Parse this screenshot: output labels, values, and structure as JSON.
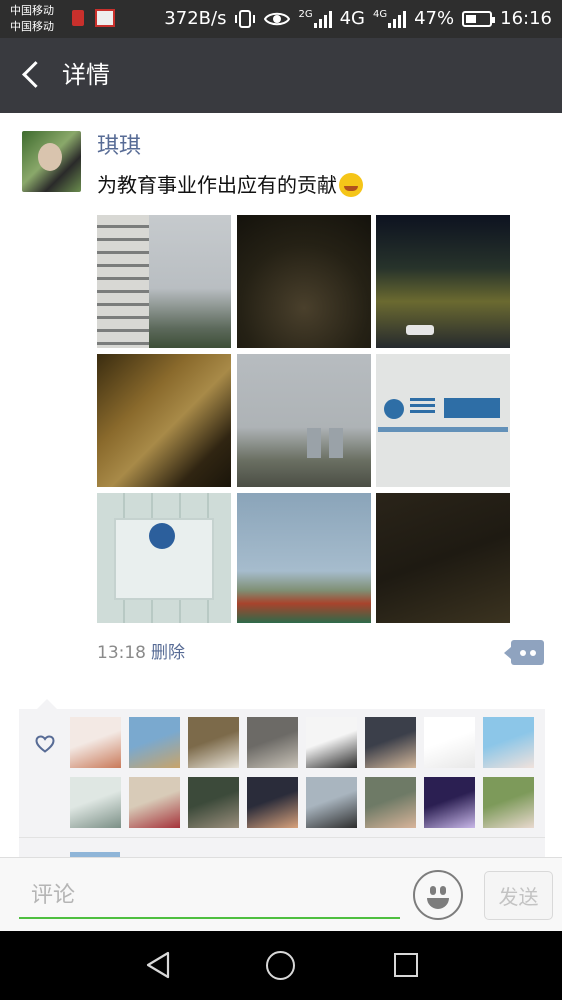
{
  "status_bar": {
    "carrier_1": "中国移动",
    "carrier_2": "中国移动",
    "speed": "372B/s",
    "net_a": "2G",
    "net_b": "4G",
    "net_c": "4G",
    "battery": "47%",
    "battery_level": 0.47,
    "time": "16:16"
  },
  "header": {
    "title": "详情",
    "back_icon": "back-arrow-icon"
  },
  "post": {
    "author": "琪琪",
    "text": "为教育事业作出应有的贡献",
    "emoji": "laughing-crying-emoji",
    "time": "13:18",
    "delete_label": "删除",
    "photo_count": 9
  },
  "likes": {
    "icon": "heart-icon",
    "likers": [
      {
        "colors": [
          "#f3e9e4",
          "#c97a5a"
        ]
      },
      {
        "colors": [
          "#7aa9cf",
          "#c8a46a"
        ]
      },
      {
        "colors": [
          "#7c6a4a",
          "#e8e3d8"
        ]
      },
      {
        "colors": [
          "#6c6a66",
          "#c9c3b8"
        ]
      },
      {
        "colors": [
          "#f5f5f5",
          "#2a2a2a"
        ]
      },
      {
        "colors": [
          "#3b3f4a",
          "#d3b79a"
        ]
      },
      {
        "colors": [
          "#ffffff",
          "#e8e8e8"
        ]
      },
      {
        "colors": [
          "#8cc6e8",
          "#f1e2dc"
        ]
      },
      {
        "colors": [
          "#dfe7e3",
          "#7b8f86"
        ]
      },
      {
        "colors": [
          "#d8cbb8",
          "#a5323a"
        ]
      },
      {
        "colors": [
          "#3c4a3a",
          "#9a8e7c"
        ]
      },
      {
        "colors": [
          "#2a2c3a",
          "#d8a27c"
        ]
      },
      {
        "colors": [
          "#a9b5bf",
          "#2e2e2e"
        ]
      },
      {
        "colors": [
          "#6e7a66",
          "#d8b49a"
        ]
      },
      {
        "colors": [
          "#2b1f52",
          "#c8b7e8"
        ]
      },
      {
        "colors": [
          "#7d9a5a",
          "#e9d9cf"
        ]
      }
    ]
  },
  "comment_bar": {
    "placeholder": "评论",
    "send_label": "发送",
    "emoji_icon": "smiley-icon"
  },
  "nav_bar": {
    "back_icon": "nav-back-icon",
    "home_icon": "nav-home-icon",
    "recent_icon": "nav-recent-icon"
  }
}
